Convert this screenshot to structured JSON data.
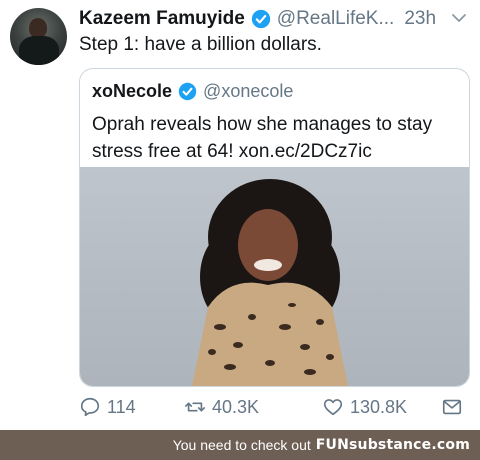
{
  "tweet": {
    "author_name": "Kazeem Famuyide",
    "author_handle": "@RealLifeK...",
    "time": "23h",
    "text": "Step 1: have a billion dollars."
  },
  "quote": {
    "author_name": "xoNecole",
    "author_handle": "@xonecole",
    "text": "Oprah reveals how she manages to stay stress free at 64! xon.ec/2DCz7ic"
  },
  "actions": {
    "replies": "114",
    "retweets": "40.3K",
    "likes": "130.8K"
  },
  "footer": {
    "text": "You need to check out",
    "brand": "FUNsubstance.com"
  },
  "colors": {
    "verified_blue": "#1da1f2",
    "secondary_text": "#657786",
    "footer_bg": "#6e5f55"
  },
  "icons": [
    "verified-badge-icon",
    "chevron-down-icon",
    "reply-icon",
    "retweet-icon",
    "like-icon",
    "message-icon"
  ]
}
